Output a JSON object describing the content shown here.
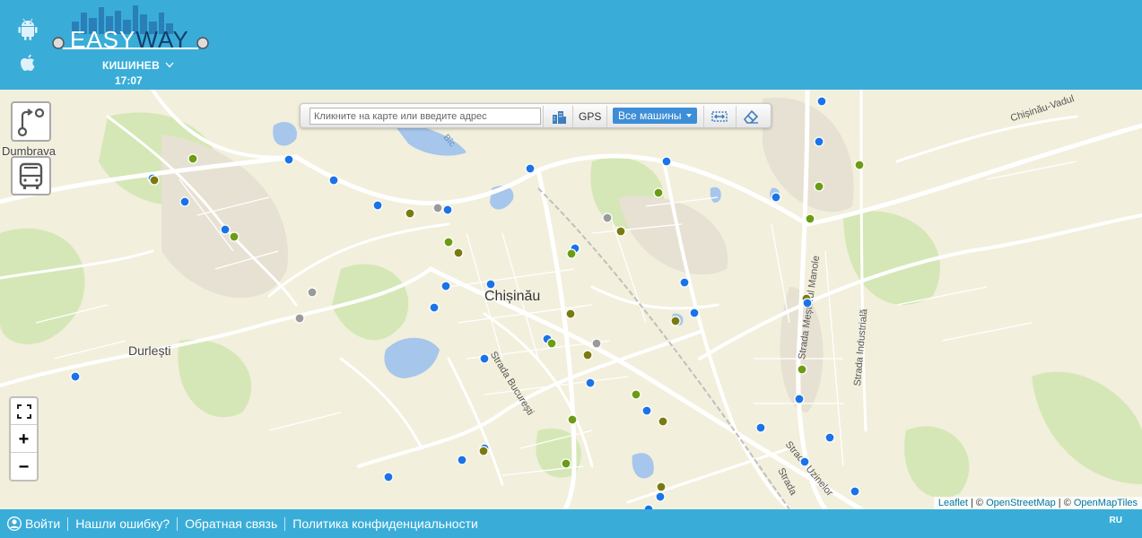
{
  "header": {
    "logo_text": "EASYWAY",
    "city": "КИШИНЕВ",
    "time": "17:07",
    "apps": [
      "android-icon",
      "apple-icon"
    ]
  },
  "toolbar": {
    "search_placeholder": "Кликните на карте или введите адрес",
    "gps_label": "GPS",
    "vehicle_filter": "Все машины",
    "icons": [
      "buildings-icon",
      "route-fit-icon",
      "eraser-icon"
    ]
  },
  "map": {
    "labels": {
      "city": "Chișinău",
      "durlesti": "Durlești",
      "dumbrava": "Dumbrava",
      "str_bucuresti": "Strada București",
      "str_uzinelor": "Strada Uzinelor",
      "str_mesterul": "Strada Meșterul Manole",
      "str_industriala": "Strada Industrială",
      "chisinau_vadul": "Chișinău-Vadul",
      "bic": "Bîc",
      "strada": "Strada"
    },
    "colors": {
      "blue": "#1a73e8",
      "green": "#6b9c14",
      "olive": "#7a7a10",
      "gray": "#9a9a9a",
      "background": "#f2efdc"
    },
    "zoom": {
      "in": "+",
      "out": "−"
    }
  },
  "attribution": {
    "leaflet": "Leaflet",
    "sep1": " | © ",
    "osm": "OpenStreetMap",
    "sep2": " | © ",
    "omt": "OpenMapTiles"
  },
  "footer": {
    "login": "Войти",
    "found_error": "Нашли ошибку?",
    "feedback": "Обратная связь",
    "privacy": "Политика конфиденциальности",
    "lang": "RU"
  }
}
